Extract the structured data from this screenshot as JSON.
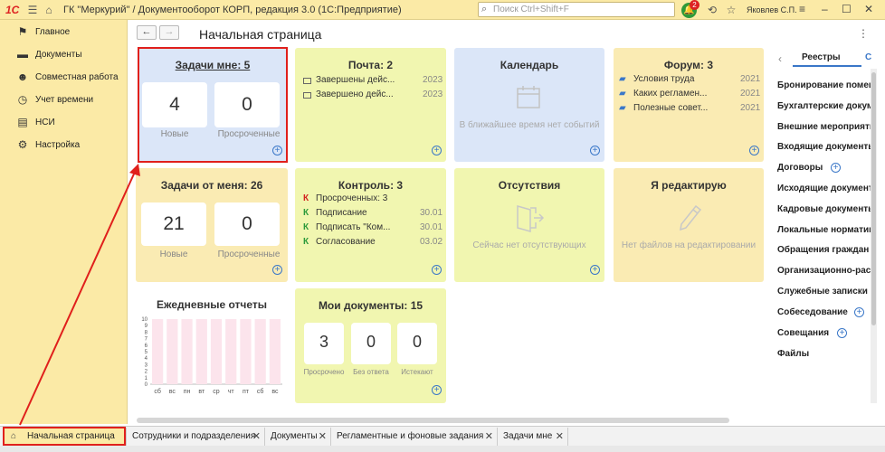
{
  "titlebar": {
    "logo": "1С",
    "title": "ГК \"Меркурий\" / Документооборот КОРП, редакция 3.0  (1С:Предприятие)",
    "search_placeholder": "Поиск Ctrl+Shift+F",
    "notifications": "2",
    "user": "Яковлев С.П."
  },
  "sidebar": {
    "items": [
      {
        "label": "Главное",
        "icon": "flag-icon"
      },
      {
        "label": "Документы",
        "icon": "folder-icon"
      },
      {
        "label": "Совместная работа",
        "icon": "people-icon"
      },
      {
        "label": "Учет времени",
        "icon": "clock-icon"
      },
      {
        "label": "НСИ",
        "icon": "book-icon"
      },
      {
        "label": "Настройка",
        "icon": "gear-icon"
      }
    ]
  },
  "page": {
    "title": "Начальная страница"
  },
  "tiles": {
    "tasks_to_me": {
      "title": "Задачи мне: 5",
      "new_count": "4",
      "new_label": "Новые",
      "overdue_count": "0",
      "overdue_label": "Просроченные"
    },
    "mail": {
      "title": "Почта: 2",
      "rows": [
        {
          "text": "Завершены дейс...",
          "year": "2023"
        },
        {
          "text": "Завершено дейс...",
          "year": "2023"
        }
      ]
    },
    "calendar": {
      "title": "Календарь",
      "empty": "В ближайшее время нет событий"
    },
    "forum": {
      "title": "Форум: 3",
      "rows": [
        {
          "text": "Условия труда",
          "year": "2021"
        },
        {
          "text": "Каких регламен...",
          "year": "2021"
        },
        {
          "text": "Полезные совет...",
          "year": "2021"
        }
      ]
    },
    "tasks_from_me": {
      "title": "Задачи от меня: 26",
      "new_count": "21",
      "new_label": "Новые",
      "overdue_count": "0",
      "overdue_label": "Просроченные"
    },
    "control": {
      "title": "Контроль: 3",
      "rows": [
        {
          "mark": "К",
          "mark_color": "#d2231f",
          "text": "Просроченных: 3",
          "date": ""
        },
        {
          "mark": "К",
          "mark_color": "#2c9a3b",
          "text": "Подписание",
          "date": "30.01"
        },
        {
          "mark": "К",
          "mark_color": "#2c9a3b",
          "text": "Подписать \"Ком...",
          "date": "30.01"
        },
        {
          "mark": "К",
          "mark_color": "#2c9a3b",
          "text": "Согласование",
          "date": "03.02"
        }
      ]
    },
    "absences": {
      "title": "Отсутствия",
      "empty": "Сейчас нет отсутствующих"
    },
    "editing": {
      "title": "Я редактирую",
      "empty": "Нет файлов на редактировании"
    },
    "daily_reports": {
      "title": "Ежедневные отчеты",
      "chart_data": {
        "type": "bar",
        "categories": [
          "сб",
          "вс",
          "пн",
          "вт",
          "ср",
          "чт",
          "пт",
          "сб",
          "вс"
        ],
        "values": [
          10,
          10,
          10,
          10,
          10,
          10,
          10,
          10,
          10
        ],
        "ylim": [
          0,
          10
        ],
        "yticks": [
          "10",
          "9",
          "8",
          "7",
          "6",
          "5",
          "4",
          "3",
          "2",
          "1",
          "0"
        ]
      }
    },
    "my_docs": {
      "title": "Мои документы: 15",
      "items": [
        {
          "count": "3",
          "label": "Просрочено"
        },
        {
          "count": "0",
          "label": "Без ответа"
        },
        {
          "count": "0",
          "label": "Истекают"
        }
      ]
    }
  },
  "registers": {
    "tab_active": "Реестры",
    "tab_next": "С",
    "items": [
      "Бронирование помещ",
      "Бухгалтерские докум",
      "Внешние мероприяти",
      "Входящие документы",
      "Договоры",
      "Исходящие документ",
      "Кадровые документы",
      "Локальные нормативн",
      "Обращения граждан",
      "Организационно-расп",
      "Служебные записки",
      "Собеседование",
      "Совещания",
      "Файлы"
    ]
  },
  "tabs": [
    {
      "label": "Начальная страница"
    },
    {
      "label": "Сотрудники и подразделения"
    },
    {
      "label": "Документы"
    },
    {
      "label": "Регламентные и фоновые задания"
    },
    {
      "label": "Задачи мне"
    }
  ],
  "colors": {
    "accent": "#fbeaa6",
    "highlight": "#e0201c",
    "link": "#3a77c8"
  }
}
